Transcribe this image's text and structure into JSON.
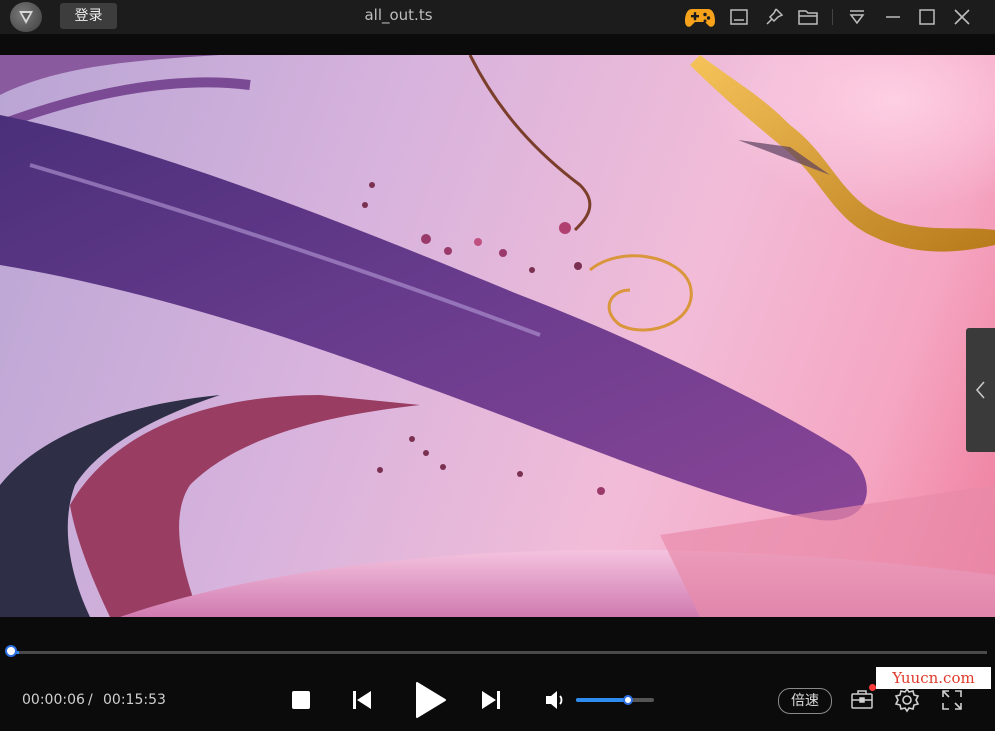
{
  "window": {
    "title": "all_out.ts",
    "login_label": "登录"
  },
  "titlebar_icons": [
    "app-logo",
    "gamepad-icon",
    "subtitle-icon",
    "pin-icon",
    "folder-icon",
    "menu-dropdown-icon",
    "minimize-icon",
    "maximize-icon",
    "close-icon"
  ],
  "player": {
    "current_time": "00:00:06",
    "separator": "/",
    "total_time": "00:15:53",
    "progress_fraction": 0.0063,
    "volume_fraction": 0.66,
    "speed_label": "倍速"
  },
  "watermark": "Yuucn.com",
  "colors": {
    "accent": "#2e8cf0",
    "gamepad": "#f7a21b",
    "notification_dot": "#ff3b3b",
    "watermark_text": "#e03a2a"
  }
}
